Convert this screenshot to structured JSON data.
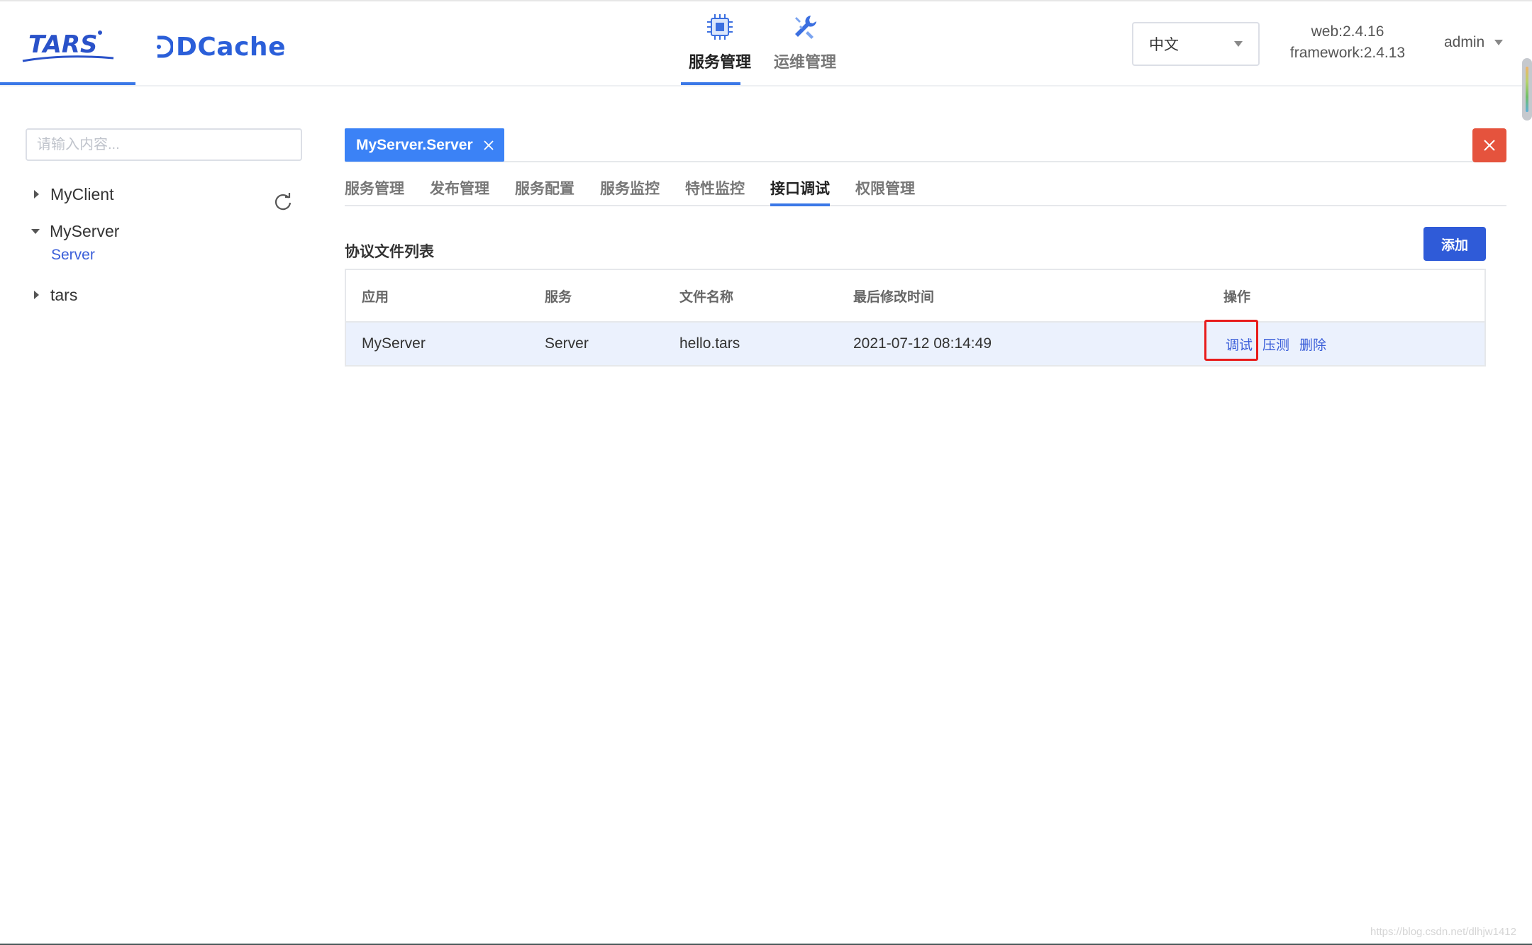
{
  "header": {
    "brand_tars": "TARS",
    "brand_dcache": "DCache",
    "nav": [
      {
        "label": "服务管理",
        "icon": "chip-icon",
        "active": true
      },
      {
        "label": "运维管理",
        "icon": "wrench-icon",
        "active": false
      }
    ],
    "language": {
      "selected": "中文"
    },
    "version": {
      "web": "web:2.4.16",
      "framework": "framework:2.4.13"
    },
    "user": {
      "name": "admin"
    }
  },
  "sidebar": {
    "search": {
      "placeholder": "请输入内容...",
      "value": ""
    },
    "tree": [
      {
        "label": "MyClient",
        "expanded": false
      },
      {
        "label": "MyServer",
        "expanded": true,
        "children": [
          "Server"
        ]
      },
      {
        "label": "tars",
        "expanded": false
      }
    ]
  },
  "main": {
    "tag": {
      "label": "MyServer.Server"
    },
    "tabs": [
      "服务管理",
      "发布管理",
      "服务配置",
      "服务监控",
      "特性监控",
      "接口调试",
      "权限管理"
    ],
    "active_tab": "接口调试",
    "section_title": "协议文件列表",
    "add_label": "添加",
    "table": {
      "columns": [
        "应用",
        "服务",
        "文件名称",
        "最后修改时间",
        "操作"
      ],
      "rows": [
        {
          "app": "MyServer",
          "server": "Server",
          "file": "hello.tars",
          "modified": "2021-07-12 08:14:49",
          "actions": [
            "调试",
            "压测",
            "删除"
          ]
        }
      ]
    }
  },
  "colors": {
    "accent": "#3b78e7",
    "tag_bg": "#3b82f6",
    "danger": "#e5533d",
    "highlight": "#e81c1c",
    "row_selected": "#ebf1fd"
  },
  "watermark": "https://blog.csdn.net/dlhjw1412"
}
